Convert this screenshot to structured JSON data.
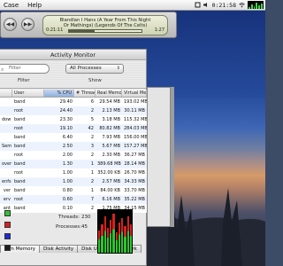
{
  "menubar": {
    "items": [
      "Case",
      "Help"
    ],
    "clock": "0:21:58",
    "mini_graph_levels": [
      0.3,
      0.6,
      0.4,
      0.9,
      0.5,
      0.7
    ]
  },
  "itunes": {
    "track_line1": "Blandlan I Hans (A Year From This Night",
    "track_line2": "Or Mathings) (Legends Of The Celts)",
    "elapsed": "0:21:11",
    "remaining": "1:27",
    "progress": 0.35,
    "prev_glyph": "◀◀",
    "play_glyph": "▶▶"
  },
  "activity_monitor": {
    "title": "Activity Monitor",
    "filter_placeholder": "Filter",
    "filter_caption": "Filter",
    "show_value": "All Processes",
    "show_caption": "Show",
    "columns": [
      "",
      "User",
      "% CPU",
      "# Threads",
      "Real Memory",
      "Virtual Memory"
    ],
    "rows": [
      {
        "name": "",
        "user": "band",
        "cpu": "29.40",
        "threads": "6",
        "rmem": "29.54 MB",
        "vmem": "193.02 MB"
      },
      {
        "name": "",
        "user": "root",
        "cpu": "24.40",
        "threads": "2",
        "rmem": "2.13 MB",
        "vmem": "30.11 MB"
      },
      {
        "name": "dow",
        "user": "band",
        "cpu": "23.30",
        "threads": "5",
        "rmem": "3.18 MB",
        "vmem": "115.32 MB"
      },
      {
        "name": "",
        "user": "root",
        "cpu": "19.10",
        "threads": "42",
        "rmem": "80.82 MB",
        "vmem": "284.03 MB"
      },
      {
        "name": "",
        "user": "band",
        "cpu": "6.40",
        "threads": "2",
        "rmem": "7.93 MB",
        "vmem": "156.00 MB"
      },
      {
        "name": "Sem",
        "user": "band",
        "cpu": "2.50",
        "threads": "3",
        "rmem": "5.67 MB",
        "vmem": "157.27 MB"
      },
      {
        "name": "",
        "user": "root",
        "cpu": "2.00",
        "threads": "2",
        "rmem": "2.30 MB",
        "vmem": "36.27 MB"
      },
      {
        "name": "over",
        "user": "band",
        "cpu": "1.30",
        "threads": "1",
        "rmem": "389.68 MB",
        "vmem": "28.14 MB"
      },
      {
        "name": "",
        "user": "root",
        "cpu": "1.00",
        "threads": "1",
        "rmem": "352.00 KB",
        "vmem": "26.70 MB"
      },
      {
        "name": "enfs",
        "user": "band",
        "cpu": "1.00",
        "threads": "2",
        "rmem": "2.57 MB",
        "vmem": "34.33 MB"
      },
      {
        "name": "ver",
        "user": "band",
        "cpu": "0.80",
        "threads": "1",
        "rmem": "84.00 KB",
        "vmem": "33.70 MB"
      },
      {
        "name": "erv",
        "user": "root",
        "cpu": "0.60",
        "threads": "7",
        "rmem": "6.16 MB",
        "vmem": "35.22 MB"
      },
      {
        "name": "ant",
        "user": "band",
        "cpu": "0.10",
        "threads": "2",
        "rmem": "1.75 MB",
        "vmem": "34.15 MB"
      }
    ],
    "tabs": [
      "tem Memory",
      "Disk Activity",
      "Disk Usage",
      "Network"
    ],
    "active_tab": 0,
    "threads_label": "Threads:",
    "threads_value": "230",
    "processes_label": "Processes:",
    "processes_value": "45",
    "swatch_colors": [
      "#2ec52e",
      "#d92020",
      "#1a2cd8",
      "#1d1d1d"
    ]
  }
}
